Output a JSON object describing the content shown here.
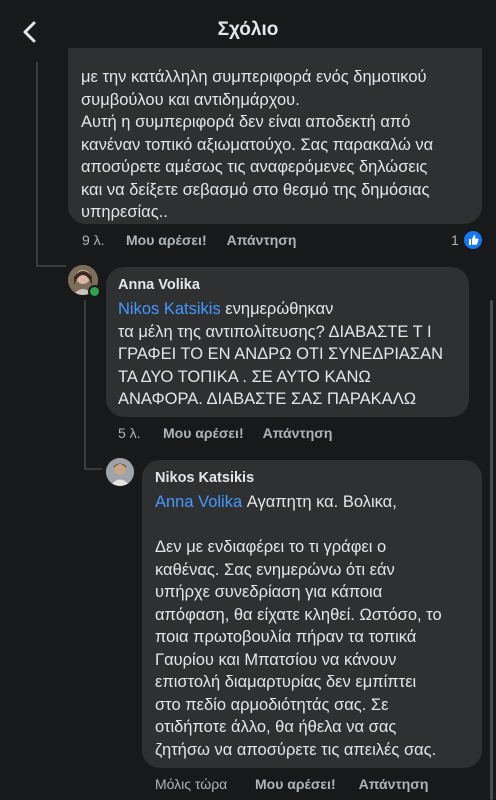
{
  "header": {
    "title": "Σχόλιο",
    "back_icon": "chevron-left-icon"
  },
  "comment1": {
    "text": "με την κατάλληλη συμπεριφορά ενός δημοτικού\nσυμβούλου και αντιδημάρχου.\nΑυτή η συμπεριφορά δεν είναι αποδεκτή από\nκανέναν τοπικό αξιωματούχο. Σας παρακαλώ να\nαποσύρετε αμέσως τις αναφερόμενες δηλώσεις\nκαι να δείξετε σεβασμό στο θεσμό της δημόσιας\nυπηρεσίας..",
    "time": "9 λ.",
    "like_label": "Μου αρέσει!",
    "reply_label": "Απάντηση",
    "like_count": "1",
    "like_icon": "thumbs-up-icon"
  },
  "comment2": {
    "author": "Anna Volika",
    "mention": "Nikos Katsikis",
    "text_first": " ενημερώθηκαν",
    "text_rest": "τα μέλη της αντιπολίτευσης? ΔΙΑΒΑΣΤΕ Τ Ι\nΓΡΑΦΕΙ ΤΟ ΕΝ ΑΝΔΡΩ ΟΤΙ ΣΥΝΕΔΡΙΑΣΑΝ\nΤΑ ΔΥΟ ΤΟΠΙΚΑ . ΣΕ ΑΥΤΟ ΚΑΝΩ\nΑΝΑΦΟΡΑ. ΔΙΑΒΑΣΤΕ ΣΑΣ ΠΑΡΑΚΑΛΩ",
    "time": "5 λ.",
    "like_label": "Μου αρέσει!",
    "reply_label": "Απάντηση"
  },
  "comment3": {
    "author": "Nikos Katsikis",
    "mention": "Anna Volika",
    "text_first": "  Αγαπητη κα. Βολικα,",
    "text_rest": "Δεν με ενδιαφέρει το τι γράφει ο\nκαθένας. Σας ενημερώνω ότι εάν\nυπήρχε συνεδρίαση για κάποια\nαπόφαση, θα είχατε κληθεί. Ωστόσο, το\nποια πρωτοβουλία πήραν τα τοπικά\nΓαυρίου και Μπατσίου να κάνουν\nεπιστολή διαμαρτυρίας δεν εμπίπτει\nστο πεδίο αρμοδιότητάς σας. Σε\nοτιδήποτε άλλο, θα ήθελα να σας\nζητήσω να αποσύρετε τις απειλές σας.",
    "time": "Μόλις τώρα",
    "like_label": "Μου αρέσει!",
    "reply_label": "Απάντηση"
  },
  "colors": {
    "background": "#18191a",
    "bubble": "#2f3031",
    "mention": "#4599ff",
    "online": "#31a24c",
    "like_badge": "#1877f2"
  }
}
